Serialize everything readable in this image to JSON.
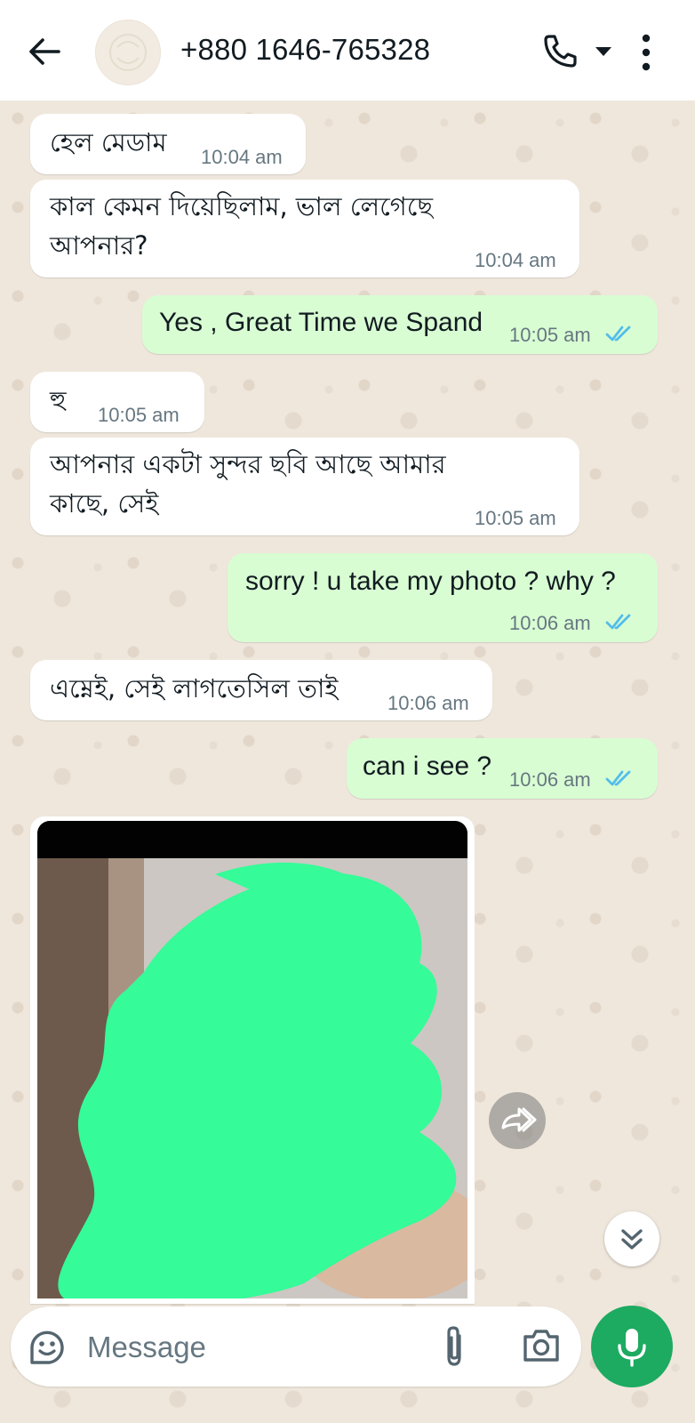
{
  "header": {
    "contact": "+880 1646-765328"
  },
  "messages": [
    {
      "text": "হেল মেডাম",
      "time": "10:04 am"
    },
    {
      "text1": "কাল কেমন দিয়েছিলাম,  ভাল লেগেছে",
      "text2": "আপনার?",
      "time": "10:04 am"
    },
    {
      "text": "Yes , Great Time we Spand",
      "time": "10:05 am"
    },
    {
      "text": "হু",
      "time": "10:05 am"
    },
    {
      "text1": "আপনার একটা সুন্দর ছবি আছে আমার",
      "text2": "কাছে,  সেই",
      "time": "10:05 am"
    },
    {
      "text": "sorry ! u take my photo ? why ?",
      "time": "10:06 am"
    },
    {
      "text": "এম্নেই,  সেই লাগতেসিল তাই",
      "time": "10:06 am"
    },
    {
      "text": "can i see ?",
      "time": "10:06 am"
    }
  ],
  "composer": {
    "placeholder": "Message"
  },
  "colors": {
    "incoming_bubble": "#ffffff",
    "outgoing_bubble": "#d9fdd3",
    "read_ticks": "#53bdeb",
    "mic_button": "#1daa61",
    "redaction": "#35fb98"
  }
}
